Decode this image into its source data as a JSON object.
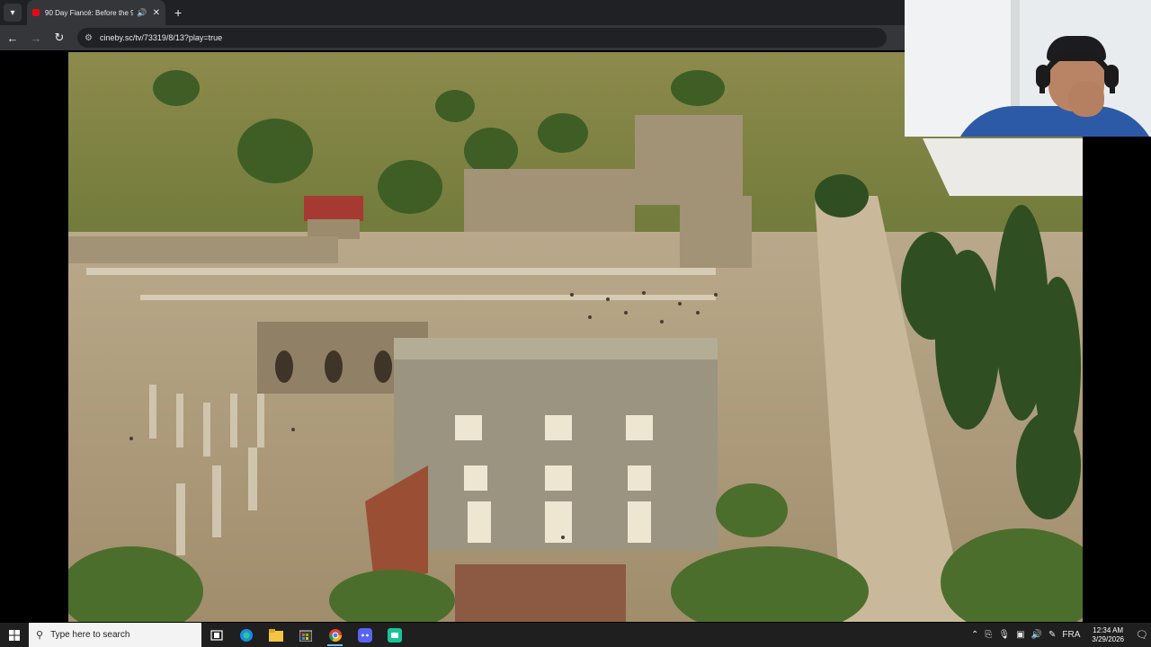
{
  "browser": {
    "tab": {
      "title": "90 Day Fiancé: Before the 9",
      "audio_icon": "speaker-icon",
      "close_icon": "close-icon"
    },
    "new_tab_icon": "plus-icon",
    "tab_search_icon": "chevron-down-icon",
    "nav": {
      "back_icon": "arrow-left-icon",
      "forward_icon": "arrow-right-icon",
      "reload_icon": "reload-icon"
    },
    "address": {
      "url": "cineby.sc/tv/73319/8/13?play=true",
      "site_info_icon": "tune-icon"
    }
  },
  "video": {
    "scene": "aerial-ruins-video-frame"
  },
  "webcam": {
    "feed": "webcam-overlay"
  },
  "taskbar": {
    "start_icon": "windows-logo-icon",
    "search_placeholder": "Type here to search",
    "search_icon": "search-icon",
    "pinned": [
      {
        "name": "task-view-icon"
      },
      {
        "name": "edge-icon"
      },
      {
        "name": "file-explorer-icon"
      },
      {
        "name": "store-icon"
      },
      {
        "name": "chrome-icon"
      },
      {
        "name": "discord-icon"
      },
      {
        "name": "app-icon"
      }
    ],
    "tray": {
      "language": "FRA",
      "time": "12:34 AM",
      "date": "3/29/2026"
    }
  },
  "colors": {
    "tabstrip": "#202124",
    "toolbar": "#35363a",
    "taskbar": "#1f1f1f",
    "accent": "#76b9ed"
  }
}
